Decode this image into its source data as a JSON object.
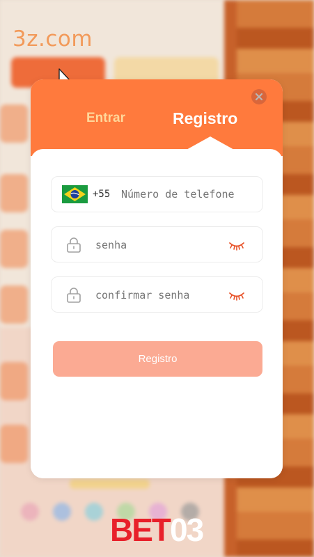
{
  "watermark": {
    "top_text": "3z.com",
    "bottom_prefix": "BET",
    "bottom_suffix": "03"
  },
  "modal": {
    "tabs": [
      {
        "label": "Entrar",
        "active": false
      },
      {
        "label": "Registro",
        "active": true
      }
    ],
    "phone": {
      "country_flag": "brazil-flag",
      "dial_code": "+55",
      "placeholder": "Número de telefone"
    },
    "password": {
      "placeholder": "senha"
    },
    "confirm_password": {
      "placeholder": "confirmar senha"
    },
    "submit_label": "Registro"
  },
  "colors": {
    "header": "#ff7a3d",
    "active_tab": "#ffffff",
    "inactive_tab": "#ffd79a",
    "submit_disabled": "#fbaa93",
    "eye_icon": "#e8532a"
  }
}
